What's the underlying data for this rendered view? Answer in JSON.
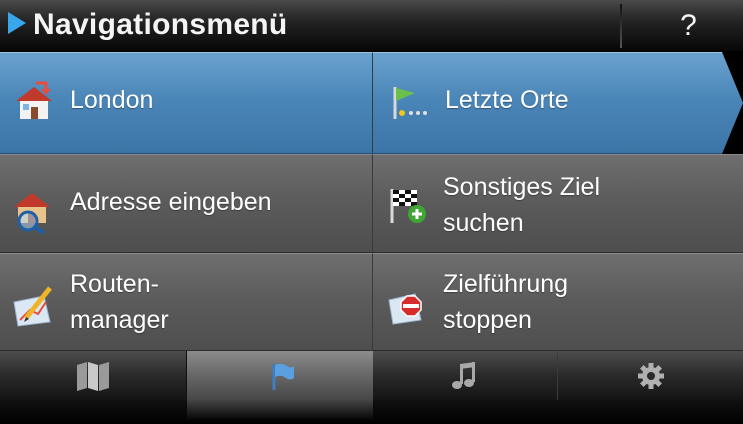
{
  "header": {
    "title": "Navigationsmenü",
    "help_label": "?",
    "play_icon": "play-triangle-icon"
  },
  "menu": {
    "items": [
      {
        "label_lines": [
          "London"
        ],
        "icon": "home-icon",
        "selected": true
      },
      {
        "label_lines": [
          "Letzte Orte"
        ],
        "icon": "recent-flag-icon",
        "selected": true
      },
      {
        "label_lines": [
          "Adresse eingeben"
        ],
        "icon": "address-search-icon",
        "selected": false
      },
      {
        "label_lines": [
          "Sonstiges Ziel",
          "suchen"
        ],
        "icon": "checkered-flag-add-icon",
        "selected": false
      },
      {
        "label_lines": [
          "Routen-",
          "manager"
        ],
        "icon": "route-pen-icon",
        "selected": false
      },
      {
        "label_lines": [
          "Zielführung",
          "stoppen"
        ],
        "icon": "stop-sign-icon",
        "selected": false
      }
    ]
  },
  "bottom_tabs": [
    {
      "icon": "map-icon",
      "active": false
    },
    {
      "icon": "flag-icon",
      "active": true
    },
    {
      "icon": "music-note-icon",
      "active": false
    },
    {
      "icon": "gear-icon",
      "active": false
    }
  ],
  "colors": {
    "accent_blue": "#4b86b8",
    "header_arrow": "#37a6ec",
    "tile_gray": "#5c5c5c"
  }
}
